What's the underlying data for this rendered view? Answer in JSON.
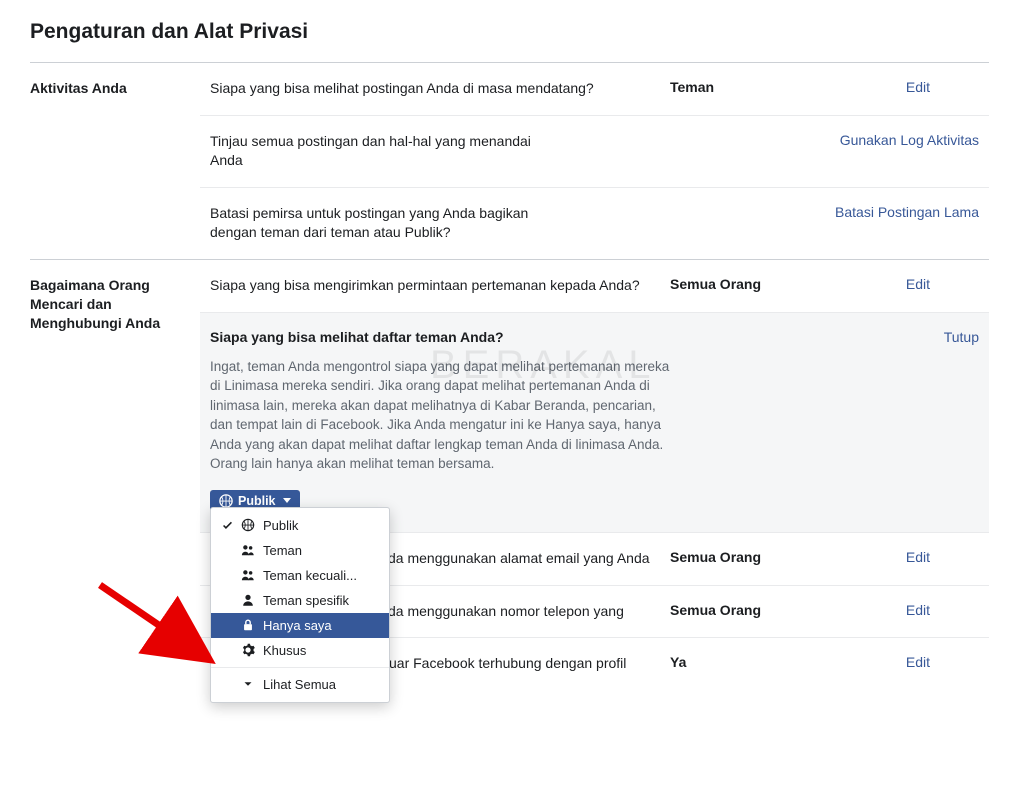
{
  "pageTitle": "Pengaturan dan Alat Privasi",
  "watermark": "BERAKAL",
  "sections": {
    "activity": {
      "label": "Aktivitas Anda",
      "rows": {
        "future": {
          "desc": "Siapa yang bisa melihat postingan Anda di masa mendatang?",
          "value": "Teman",
          "action": "Edit"
        },
        "review": {
          "desc": "Tinjau semua postingan dan hal-hal yang menandai Anda",
          "action": "Gunakan Log Aktivitas"
        },
        "limit": {
          "desc": "Batasi pemirsa untuk postingan yang Anda bagikan dengan teman dari teman atau Publik?",
          "action": "Batasi Postingan Lama"
        }
      }
    },
    "contact": {
      "label": "Bagaimana Orang Mencari dan Menghubungi Anda",
      "rows": {
        "friendreq": {
          "desc": "Siapa yang bisa mengirimkan permintaan pertemanan kepada Anda?",
          "value": "Semua Orang",
          "action": "Edit"
        },
        "friendlist": {
          "title": "Siapa yang bisa melihat daftar teman Anda?",
          "close": "Tutup",
          "text": "Ingat, teman Anda mengontrol siapa yang dapat melihat pertemanan mereka di Linimasa mereka sendiri. Jika orang dapat melihat pertemanan Anda di linimasa lain, mereka akan dapat melihatnya di Kabar Beranda, pencarian, dan tempat lain di Facebook. Jika Anda mengatur ini ke Hanya saya, hanya Anda yang akan dapat melihat daftar lengkap teman Anda di linimasa Anda. Orang lain hanya akan melihat teman bersama.",
          "buttonLabel": "Publik",
          "dropdown": {
            "items": [
              {
                "label": "Publik",
                "icon": "globe",
                "checked": true,
                "selected": false
              },
              {
                "label": "Teman",
                "icon": "friends",
                "checked": false,
                "selected": false
              },
              {
                "label": "Teman kecuali...",
                "icon": "friends",
                "checked": false,
                "selected": false
              },
              {
                "label": "Teman spesifik",
                "icon": "person",
                "checked": false,
                "selected": false
              },
              {
                "label": "Hanya saya",
                "icon": "lock",
                "checked": false,
                "selected": true
              },
              {
                "label": "Khusus",
                "icon": "gear",
                "checked": false,
                "selected": false
              },
              {
                "label": "Lihat Semua",
                "icon": "downarrow",
                "checked": false,
                "selected": false,
                "separatorBefore": true
              }
            ]
          }
        },
        "email": {
          "desc": "ri Anda menggunakan alamat email yang Anda",
          "value": "Semua Orang",
          "action": "Edit"
        },
        "phone": {
          "desc": "ri Anda menggunakan nomor telepon yang",
          "value": "Semua Orang",
          "action": "Edit"
        },
        "search": {
          "desc": "Anda ingin mesin pencari di luar Facebook terhubung dengan profil Anda?",
          "value": "Ya",
          "action": "Edit"
        }
      }
    }
  }
}
